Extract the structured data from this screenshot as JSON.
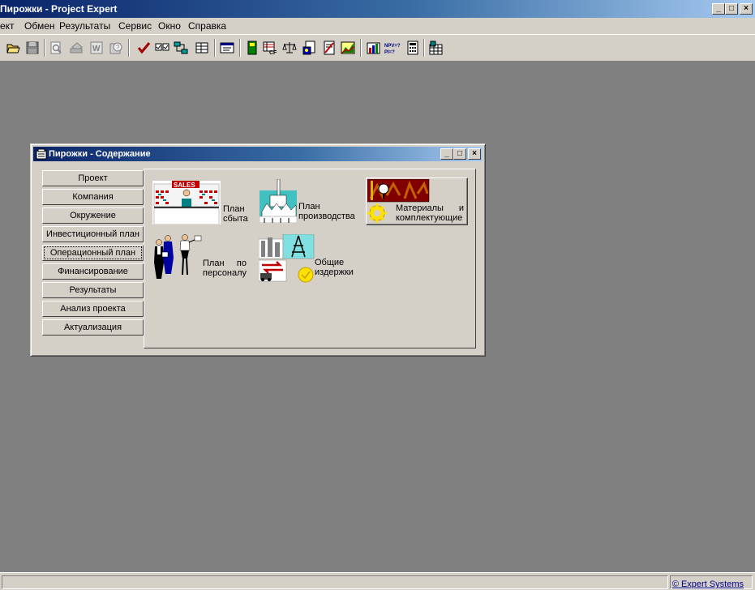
{
  "app": {
    "title": "Пирожки - Project Expert"
  },
  "menu": [
    "ект",
    "Обмен",
    "Результаты",
    "Сервис",
    "Окно",
    "Справка"
  ],
  "toolbar": {
    "icons": [
      "open-folder-icon",
      "save-disk-icon",
      "print-preview-icon",
      "print-icon",
      "word-export-icon",
      "query-icon",
      "check-icon",
      "list-icon",
      "network-icon",
      "table-icon",
      "window-icon",
      "book-icon",
      "cashflow-icon",
      "balance-icon",
      "calculator-report-icon",
      "document-icon",
      "chart-icon",
      "bars-icon",
      "npv-pi-icon",
      "calculator-icon",
      "database-icon"
    ]
  },
  "child_window": {
    "title": "Пирожки - Содержание",
    "nav": [
      {
        "label": "Проект"
      },
      {
        "label": "Компания"
      },
      {
        "label": "Окружение"
      },
      {
        "label": "Инвестиционный план"
      },
      {
        "label": "Операционный план",
        "active": true
      },
      {
        "label": "Финансирование"
      },
      {
        "label": "Результаты"
      },
      {
        "label": "Анализ проекта"
      },
      {
        "label": "Актуализация"
      }
    ],
    "items": {
      "sales_plan": {
        "line1": "План",
        "line2": "сбыта",
        "image_text": "SALES"
      },
      "production_plan": {
        "line1": "План",
        "line2": "производства"
      },
      "materials": {
        "line1a": "Материалы",
        "line1b": "и",
        "line2": "комплектующие"
      },
      "personnel_plan": {
        "line1a": "План",
        "line1b": "по",
        "line2": "персоналу"
      },
      "overheads": {
        "line1": "Общие",
        "line2": "издержки"
      }
    }
  },
  "status": {
    "copyright": "© Expert Systems"
  },
  "colors": {
    "title_start": "#0a246a",
    "title_end": "#a6caf0",
    "face": "#d4d0c8",
    "desktop": "#808080",
    "link": "#00008b"
  }
}
